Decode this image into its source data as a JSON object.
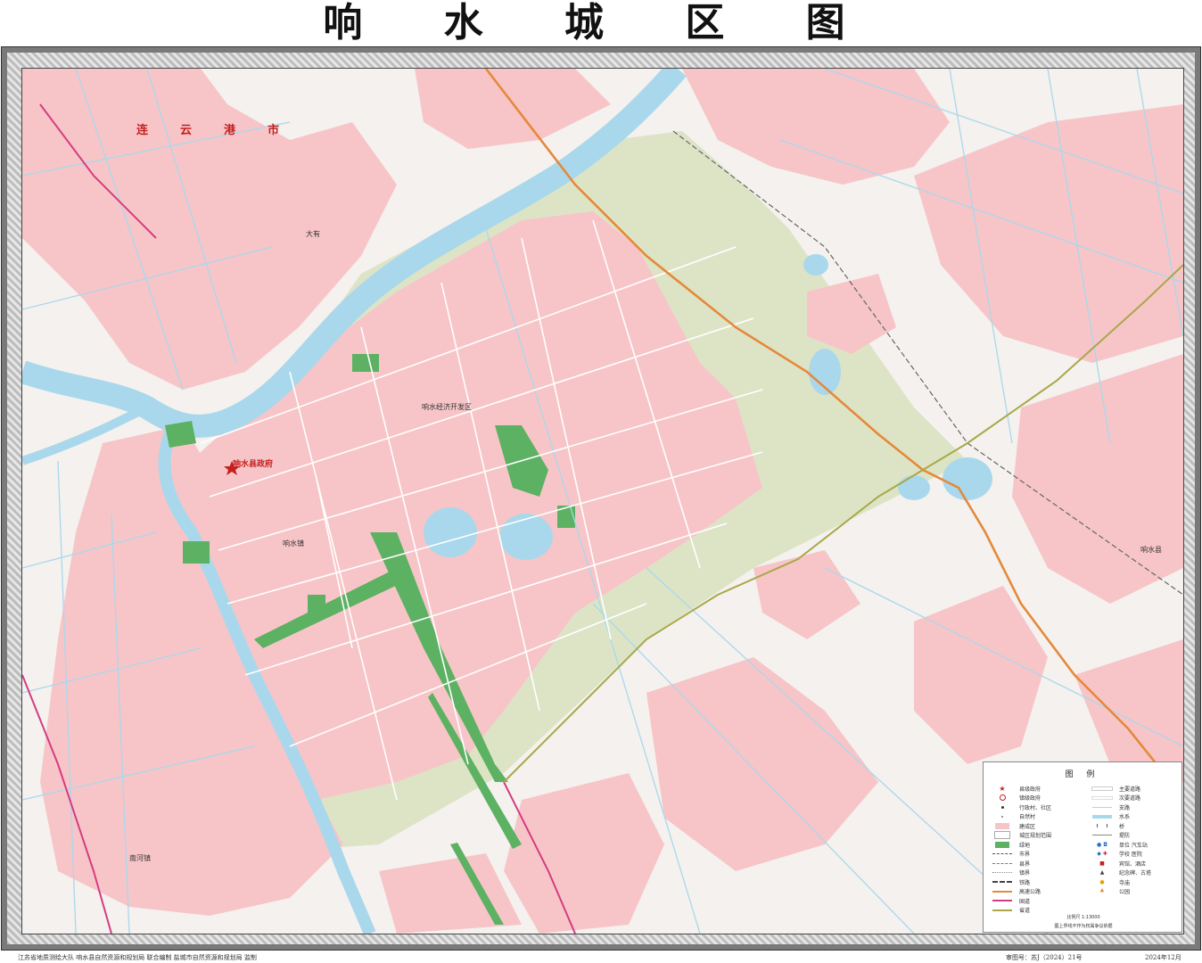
{
  "title": "响 水 城 区 图",
  "map": {
    "city_label": "连云港市",
    "county_gov_label": "响水县政府",
    "place_labels": [
      {
        "id": "p1",
        "text": "响水经济开发区"
      },
      {
        "id": "p2",
        "text": "响水镇"
      },
      {
        "id": "p3",
        "text": "响水县"
      },
      {
        "id": "p4",
        "text": "大有"
      },
      {
        "id": "p5",
        "text": "南河镇"
      }
    ]
  },
  "legend": {
    "title": "图 例",
    "left_items": [
      {
        "label": "县级政府",
        "sym": "star"
      },
      {
        "label": "镇级政府",
        "sym": "circle"
      },
      {
        "label": "行政村、社区",
        "sym": "dot"
      },
      {
        "label": "自然村",
        "sym": "small"
      },
      {
        "label": "建成区",
        "sym": "pink"
      },
      {
        "label": "城区规划范围",
        "sym": "box"
      },
      {
        "label": "绿地",
        "sym": "green"
      },
      {
        "label": "市界",
        "sym": "dash1"
      },
      {
        "label": "县界",
        "sym": "dash2"
      },
      {
        "label": "镇界",
        "sym": "dash3"
      },
      {
        "label": "铁路",
        "sym": "rail"
      },
      {
        "label": "高速公路",
        "sym": "orange"
      },
      {
        "label": "国道",
        "sym": "magenta"
      },
      {
        "label": "省道",
        "sym": "olive"
      }
    ],
    "right_items": [
      {
        "label": "主要道路",
        "sym": "road2"
      },
      {
        "label": "次要道路",
        "sym": "road1"
      },
      {
        "label": "支路",
        "sym": "road0"
      },
      {
        "label": "水系",
        "sym": "water"
      },
      {
        "label": "桥",
        "sym": "bridge"
      },
      {
        "label": "堤防",
        "sym": "dike"
      },
      {
        "label": "单位  汽车站",
        "sym": "unit"
      },
      {
        "label": "学校  医院",
        "sym": "school"
      },
      {
        "label": "宾馆、酒店",
        "sym": "hotel"
      },
      {
        "label": "纪念碑、古塔",
        "sym": "monument"
      },
      {
        "label": "寺庙",
        "sym": "temple"
      },
      {
        "label": "公园",
        "sym": "park"
      }
    ],
    "scale": "比例尺 1:13000",
    "note": "图上界线不作为权属争议依据"
  },
  "footer": {
    "left": "江苏省地质测绘大队    响水县自然资源和规划局    联合编制    盐城市自然资源和规划局    监制",
    "review": "审图号：苏J（2024）21号",
    "date": "2024年12月"
  },
  "colors": {
    "builtup": "#f7c5c8",
    "green": "#5cb162",
    "water": "#a9d8ec",
    "plan": "#d9e2c3",
    "highway": "#e5893a",
    "national": "#d43c82",
    "provincial": "#a8a849"
  }
}
